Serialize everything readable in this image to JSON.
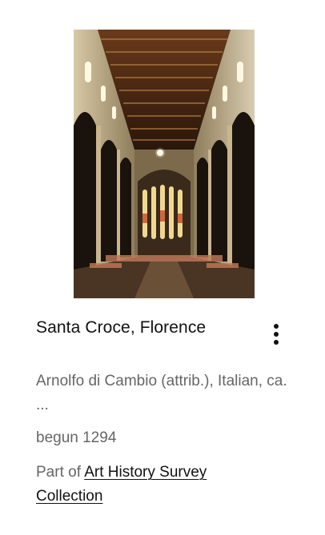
{
  "item": {
    "title": "Santa Croce, Florence",
    "creator": "Arnolfo di Cambio (attrib.), Italian, ca. ...",
    "date": "begun 1294",
    "part_of_prefix": "Part of ",
    "collection_link": "Art History Survey Collection",
    "menu_icon": "more-vertical-icon",
    "image_icon": "church-interior-image"
  },
  "colors": {
    "title": "#111111",
    "meta": "#666666",
    "link": "#111111",
    "background": "#ffffff"
  }
}
